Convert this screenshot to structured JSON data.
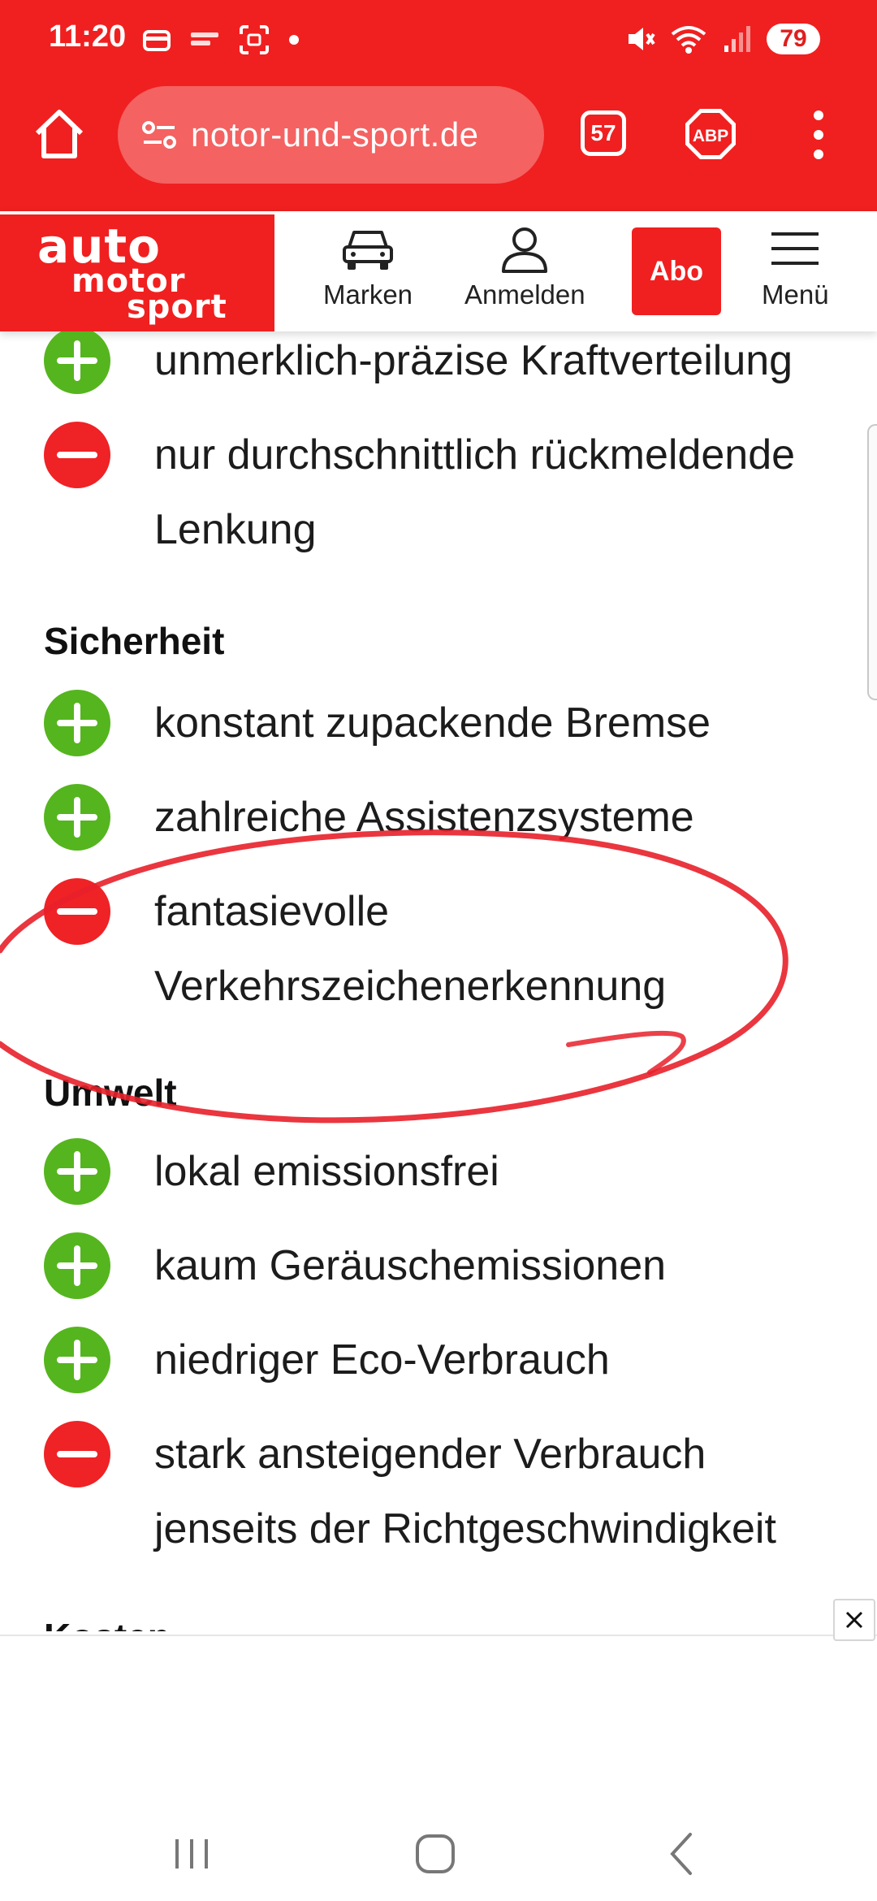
{
  "status_bar": {
    "time": "11:20",
    "battery": "79",
    "left_icons": [
      "wallet-icon",
      "consorsbank-icon",
      "screenshot-icon",
      "dot-icon"
    ],
    "right_icons": [
      "mute-icon",
      "wifi-icon",
      "signal-icon"
    ]
  },
  "browser": {
    "url": "notor-und-sport.de",
    "tab_count": "57",
    "abp_label": "ABP",
    "theme_color": "#f02020"
  },
  "site_header": {
    "logo": [
      "auto",
      "motor",
      "sport"
    ],
    "brands_label": "Marken",
    "login_label": "Anmelden",
    "abo_label": "Abo",
    "menu_label": "Menü"
  },
  "content": {
    "items_top": [
      {
        "type": "plus",
        "lines": [
          "unmerklich-präzise Kraftverteilung"
        ]
      },
      {
        "type": "minus",
        "lines": [
          "nur durchschnittlich rückmeldende",
          "Lenkung"
        ]
      }
    ],
    "sections": [
      {
        "title": "Sicherheit",
        "items": [
          {
            "type": "plus",
            "lines": [
              "konstant zupackende Bremse"
            ]
          },
          {
            "type": "plus",
            "lines": [
              "zahlreiche Assistenzsysteme"
            ]
          },
          {
            "type": "minus",
            "lines": [
              "fantasievolle",
              "Verkehrszeichenerkennung"
            ]
          }
        ]
      },
      {
        "title": "Umwelt",
        "items": [
          {
            "type": "plus",
            "lines": [
              "lokal emissionsfrei"
            ]
          },
          {
            "type": "plus",
            "lines": [
              "kaum Geräuschemissionen"
            ]
          },
          {
            "type": "plus",
            "lines": [
              "niedriger Eco-Verbrauch"
            ]
          },
          {
            "type": "minus",
            "lines": [
              "stark ansteigender Verbrauch",
              "jenseits der Richtgeschwindigkeit"
            ]
          }
        ]
      },
      {
        "title": "Kosten",
        "items": []
      }
    ],
    "plus_color": "#55b51e",
    "minus_color": "#ef2226"
  },
  "annotation_color": "#e8202a"
}
